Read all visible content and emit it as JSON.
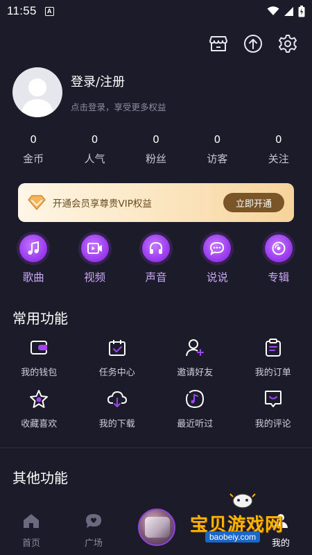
{
  "status_bar": {
    "time": "11:55",
    "notification_badge": "A"
  },
  "top_actions": [
    {
      "name": "store-icon"
    },
    {
      "name": "upload-icon"
    },
    {
      "name": "settings-icon"
    }
  ],
  "profile": {
    "title": "登录/注册",
    "subtitle": "点击登录，享受更多权益"
  },
  "stats": [
    {
      "value": "0",
      "label": "金币"
    },
    {
      "value": "0",
      "label": "人气"
    },
    {
      "value": "0",
      "label": "粉丝"
    },
    {
      "value": "0",
      "label": "访客"
    },
    {
      "value": "0",
      "label": "关注"
    }
  ],
  "vip": {
    "text": "开通会员享尊贵VIP权益",
    "button": "立即开通"
  },
  "categories": [
    {
      "label": "歌曲",
      "icon": "music-note-icon"
    },
    {
      "label": "视频",
      "icon": "video-icon"
    },
    {
      "label": "声音",
      "icon": "headphones-icon"
    },
    {
      "label": "说说",
      "icon": "chat-bubble-icon"
    },
    {
      "label": "专辑",
      "icon": "disc-icon"
    }
  ],
  "common_functions": {
    "title": "常用功能",
    "items": [
      {
        "label": "我的钱包",
        "icon": "wallet-icon"
      },
      {
        "label": "任务中心",
        "icon": "task-calendar-icon"
      },
      {
        "label": "邀请好友",
        "icon": "add-user-icon"
      },
      {
        "label": "我的订单",
        "icon": "order-clipboard-icon"
      },
      {
        "label": "收藏喜欢",
        "icon": "star-icon"
      },
      {
        "label": "我的下载",
        "icon": "cloud-download-icon"
      },
      {
        "label": "最近听过",
        "icon": "recent-music-icon"
      },
      {
        "label": "我的评论",
        "icon": "comment-icon"
      }
    ]
  },
  "other_functions": {
    "title": "其他功能"
  },
  "tabbar": {
    "items": [
      {
        "label": "首页",
        "icon": "home-icon"
      },
      {
        "label": "广场",
        "icon": "square-chat-icon"
      },
      {
        "label": "我的",
        "icon": "profile-icon",
        "active": true
      }
    ]
  },
  "watermark": {
    "brand": "宝贝游戏网",
    "url": "baobeiy.com"
  },
  "colors": {
    "background": "#1c1b2a",
    "accent_purple": "#9d3df0",
    "vip_gold": "#7a5528"
  }
}
